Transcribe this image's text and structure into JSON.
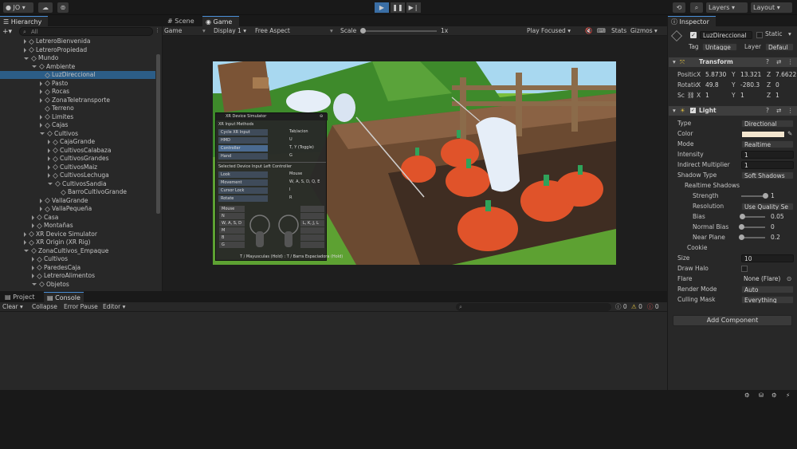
{
  "topbar": {
    "account": "JO",
    "layers": "Layers",
    "layout": "Layout"
  },
  "hierarchy": {
    "tab": "Hierarchy",
    "search_placeholder": "All",
    "items": [
      {
        "label": "LetreroBienvenida",
        "depth": 2,
        "arrow": "right",
        "selected": false
      },
      {
        "label": "LetreroPropiedad",
        "depth": 2,
        "arrow": "right",
        "selected": false
      },
      {
        "label": "Mundo",
        "depth": 2,
        "arrow": "down",
        "selected": false
      },
      {
        "label": "Ambiente",
        "depth": 3,
        "arrow": "down",
        "selected": false
      },
      {
        "label": "LuzDireccional",
        "depth": 4,
        "arrow": "",
        "selected": true
      },
      {
        "label": "Pasto",
        "depth": 4,
        "arrow": "right",
        "selected": false
      },
      {
        "label": "Rocas",
        "depth": 4,
        "arrow": "right",
        "selected": false
      },
      {
        "label": "ZonaTeletransporte",
        "depth": 4,
        "arrow": "right",
        "selected": false
      },
      {
        "label": "Terreno",
        "depth": 4,
        "arrow": "",
        "selected": false
      },
      {
        "label": "Limites",
        "depth": 4,
        "arrow": "right",
        "selected": false
      },
      {
        "label": "Cajas",
        "depth": 4,
        "arrow": "right",
        "selected": false
      },
      {
        "label": "Cultivos",
        "depth": 4,
        "arrow": "down",
        "selected": false
      },
      {
        "label": "CajaGrande",
        "depth": 5,
        "arrow": "right",
        "selected": false
      },
      {
        "label": "CultivosCalabaza",
        "depth": 5,
        "arrow": "right",
        "selected": false
      },
      {
        "label": "CultivosGrandes",
        "depth": 5,
        "arrow": "right",
        "selected": false
      },
      {
        "label": "CultivosMaiz",
        "depth": 5,
        "arrow": "right",
        "selected": false
      },
      {
        "label": "CultivosLechuga",
        "depth": 5,
        "arrow": "right",
        "selected": false
      },
      {
        "label": "CultivosSandia",
        "depth": 5,
        "arrow": "down",
        "selected": false
      },
      {
        "label": "BarroCultivoGrande",
        "depth": 6,
        "arrow": "",
        "selected": false
      },
      {
        "label": "VallaGrande",
        "depth": 4,
        "arrow": "right",
        "selected": false
      },
      {
        "label": "VallaPequeña",
        "depth": 4,
        "arrow": "right",
        "selected": false
      },
      {
        "label": "Casa",
        "depth": 3,
        "arrow": "right",
        "selected": false
      },
      {
        "label": "Montañas",
        "depth": 3,
        "arrow": "right",
        "selected": false
      },
      {
        "label": "XR Device Simulator",
        "depth": 2,
        "arrow": "right",
        "selected": false
      },
      {
        "label": "XR Origin (XR Rig)",
        "depth": 2,
        "arrow": "right",
        "selected": false
      },
      {
        "label": "ZonaCultivos_Empaque",
        "depth": 2,
        "arrow": "down",
        "selected": false
      },
      {
        "label": "Cultivos",
        "depth": 3,
        "arrow": "right",
        "selected": false
      },
      {
        "label": "ParedesCaja",
        "depth": 3,
        "arrow": "right",
        "selected": false
      },
      {
        "label": "LetreroAlimentos",
        "depth": 3,
        "arrow": "right",
        "selected": false
      },
      {
        "label": "Objetos",
        "depth": 3,
        "arrow": "down",
        "selected": false
      }
    ]
  },
  "scene": {
    "tabs": [
      "Scene",
      "Game"
    ],
    "game_dropdown": "Game",
    "display": "Display 1",
    "aspect": "Free Aspect",
    "scale_label": "Scale",
    "scale_value": "1x",
    "play_focused": "Play Focused",
    "stats": "Stats",
    "gizmos": "Gizmos"
  },
  "xr_sim": {
    "title": "XR Device Simulator",
    "input_methods": "XR Input Methods",
    "rows": [
      {
        "btn": "Cycle XR Input",
        "hint": "Tab/acion"
      },
      {
        "btn": "HMD",
        "hint": "U"
      },
      {
        "btn": "Controller",
        "hint": "T, Y (Toggle)"
      },
      {
        "btn": "Hand",
        "hint": "G"
      }
    ],
    "selected_header": "Selected Device Input Left Controller",
    "rows2": [
      {
        "btn": "Look",
        "hint": "Mouse"
      },
      {
        "btn": "Movement",
        "hint": "W, A, S, D, Q, E"
      },
      {
        "btn": "Cursor Lock",
        "hint": "I"
      },
      {
        "btn": "Rotate",
        "hint": "R"
      }
    ],
    "ctrl_left": [
      "Mouse",
      "N",
      "W, A, S, D",
      "M",
      "B",
      "G"
    ],
    "ctrl_right": [
      "",
      "",
      "L, K, J, L",
      "",
      "",
      ""
    ],
    "footer": "T / Mayusculas (Hold) : T / Barra Espaciadora (Hold)"
  },
  "bottom": {
    "tabs": [
      "Project",
      "Console"
    ],
    "toolbar": [
      "Clear",
      "Collapse",
      "Error Pause",
      "Editor"
    ],
    "counts": [
      "0",
      "0",
      "0"
    ]
  },
  "inspector": {
    "tab": "Inspector",
    "object_name": "LuzDireccional",
    "static_label": "Static",
    "tag_label": "Tag",
    "tag_value": "Untagge",
    "layer_label": "Layer",
    "layer_value": "Defaul",
    "transform": {
      "title": "Transform",
      "position_label": "Positic",
      "pos": {
        "x": "5.8730",
        "y": "13.321",
        "z": "7.6622"
      },
      "rotation_label": "Rotatic",
      "rot": {
        "x": "49.8",
        "y": "-280.3",
        "z": "0"
      },
      "scale_label": "Sc",
      "scl": {
        "x": "1",
        "y": "1",
        "z": "1"
      }
    },
    "light": {
      "title": "Light",
      "props": [
        {
          "label": "Type",
          "value": "Directional",
          "kind": "drop"
        },
        {
          "label": "Color",
          "value": "",
          "kind": "color"
        },
        {
          "label": "Mode",
          "value": "Realtime",
          "kind": "drop"
        },
        {
          "label": "Intensity",
          "value": "1",
          "kind": "field"
        },
        {
          "label": "Indirect Multiplier",
          "value": "1",
          "kind": "field"
        },
        {
          "label": "Shadow Type",
          "value": "Soft Shadows",
          "kind": "drop"
        }
      ],
      "realtime_shadows": "Realtime Shadows",
      "shadow_props": [
        {
          "label": "Strength",
          "value": "1",
          "slider": 1.0
        },
        {
          "label": "Resolution",
          "value": "Use Quality Se",
          "kind": "drop"
        },
        {
          "label": "Bias",
          "value": "0.05",
          "slider": 0.025
        },
        {
          "label": "Normal Bias",
          "value": "0",
          "slider": 0.0
        },
        {
          "label": "Near Plane",
          "value": "0.2",
          "slider": 0.0
        }
      ],
      "cookie": "Cookie",
      "props2": [
        {
          "label": "Size",
          "value": "10",
          "kind": "field"
        },
        {
          "label": "Draw Halo",
          "value": "",
          "kind": "check"
        },
        {
          "label": "Flare",
          "value": "None (Flare)",
          "kind": "obj"
        },
        {
          "label": "Render Mode",
          "value": "Auto",
          "kind": "drop"
        },
        {
          "label": "Culling Mask",
          "value": "Everything",
          "kind": "drop"
        }
      ],
      "color_hex": "#f3e6cf"
    },
    "add_component": "Add Component"
  }
}
